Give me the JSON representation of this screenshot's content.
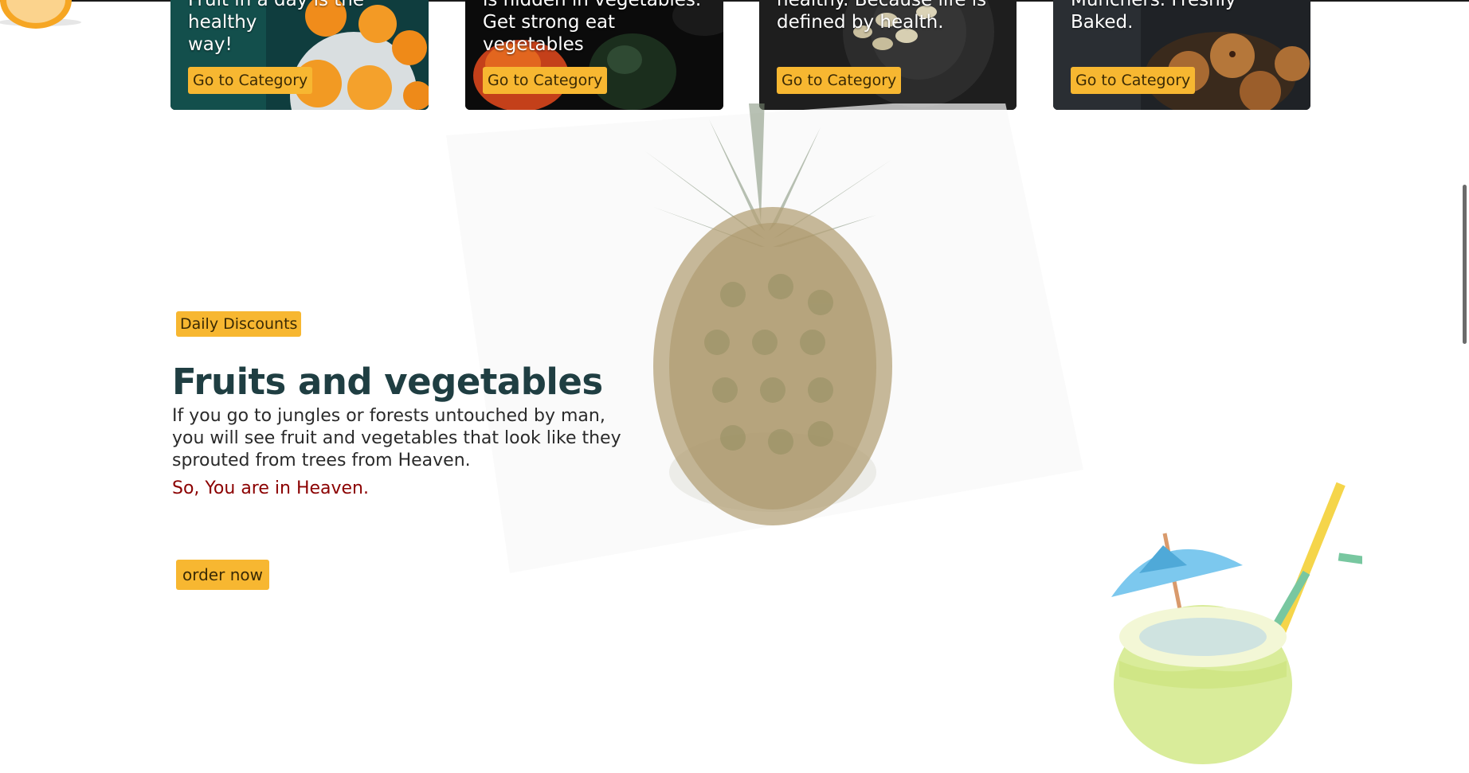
{
  "categories": [
    {
      "line1": "Fruit in a day is the healthy",
      "line2": "way!",
      "button": "Go to Category"
    },
    {
      "line1": "is hidden in vegetables.",
      "line2": "Get strong eat vegetables",
      "button": "Go to Category"
    },
    {
      "line1": "healthy. Because life is",
      "line2": "defined by health.",
      "button": "Go to Category"
    },
    {
      "line1": "Munchers. Freshly Baked.",
      "line2": "",
      "button": "Go to Category"
    }
  ],
  "hero": {
    "badge": "Daily Discounts",
    "title": "Fruits and vegetables",
    "description": "If you go to jungles or forests untouched by man, you will see fruit and vegetables that look like they sprouted from trees from Heaven.",
    "note": "So, You are in Heaven.",
    "order_button": "order now"
  },
  "colors": {
    "accent": "#f7b731",
    "title": "#1f3e42",
    "note": "#8b0000"
  }
}
